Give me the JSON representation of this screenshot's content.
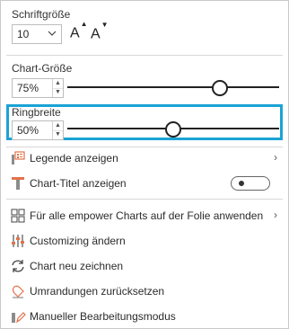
{
  "font_size": {
    "label": "Schriftgröße",
    "value": "10",
    "increase_label": "A",
    "decrease_label": "A"
  },
  "chart_size": {
    "label": "Chart-Größe",
    "value": "75%",
    "level": 0.72
  },
  "ring_width": {
    "label": "Ringbreite",
    "value": "50%",
    "level": 0.5
  },
  "menu": {
    "legend": "Legende anzeigen",
    "chart_title": "Chart-Titel anzeigen",
    "apply_all": "Für alle empower Charts auf der Folie anwenden",
    "customizing": "Customizing ändern",
    "redraw": "Chart neu zeichnen",
    "reset_borders": "Umrandungen zurücksetzen",
    "manual_mode": "Manueller Bearbeitungsmodus",
    "submenu_arrow": "›"
  },
  "colors": {
    "highlight": "#1aa3d6",
    "accent_orange": "#e2724a"
  }
}
